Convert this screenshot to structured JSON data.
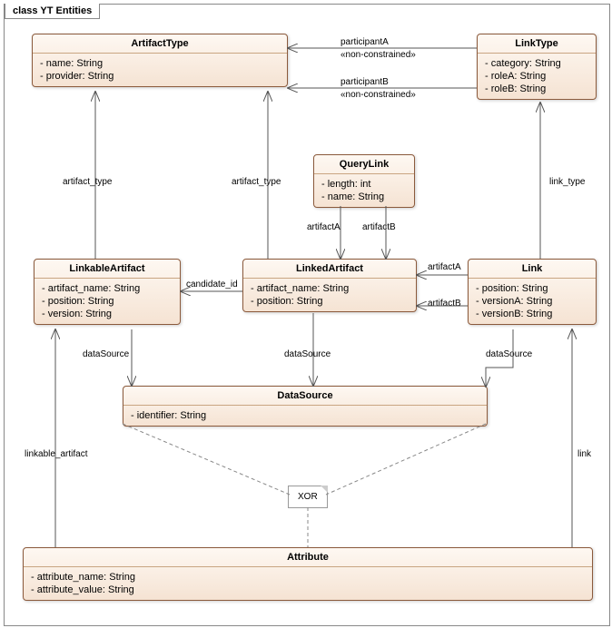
{
  "frame_title": "class YT Entities",
  "classes": {
    "ArtifactType": {
      "name": "ArtifactType",
      "attrs": [
        "name: String",
        "provider: String"
      ]
    },
    "LinkType": {
      "name": "LinkType",
      "attrs": [
        "category: String",
        "roleA: String",
        "roleB: String"
      ]
    },
    "QueryLink": {
      "name": "QueryLink",
      "attrs": [
        "length: int",
        "name: String"
      ]
    },
    "LinkableArtifact": {
      "name": "LinkableArtifact",
      "attrs": [
        "artifact_name: String",
        "position: String",
        "version: String"
      ]
    },
    "LinkedArtifact": {
      "name": "LinkedArtifact",
      "attrs": [
        "artifact_name: String",
        "position: String"
      ]
    },
    "Link": {
      "name": "Link",
      "attrs": [
        "position: String",
        "versionA: String",
        "versionB: String"
      ]
    },
    "DataSource": {
      "name": "DataSource",
      "attrs": [
        "identifier: String"
      ]
    },
    "Attribute": {
      "name": "Attribute",
      "attrs": [
        "attribute_name: String",
        "attribute_value: String"
      ]
    }
  },
  "labels": {
    "participantA": "participantA",
    "participantB": "participantB",
    "nonconstrained": "«non-constrained»",
    "artifact_type": "artifact_type",
    "link_type": "link_type",
    "artifactA": "artifactA",
    "artifactB": "artifactB",
    "candidate_id": "candidate_id",
    "dataSource": "dataSource",
    "linkable_artifact": "linkable_artifact",
    "link": "link",
    "xor": "XOR"
  },
  "chart_data": {
    "type": "uml-class-diagram",
    "classes": [
      {
        "name": "ArtifactType",
        "attributes": [
          {
            "name": "name",
            "type": "String"
          },
          {
            "name": "provider",
            "type": "String"
          }
        ]
      },
      {
        "name": "LinkType",
        "attributes": [
          {
            "name": "category",
            "type": "String"
          },
          {
            "name": "roleA",
            "type": "String"
          },
          {
            "name": "roleB",
            "type": "String"
          }
        ]
      },
      {
        "name": "QueryLink",
        "attributes": [
          {
            "name": "length",
            "type": "int"
          },
          {
            "name": "name",
            "type": "String"
          }
        ]
      },
      {
        "name": "LinkableArtifact",
        "attributes": [
          {
            "name": "artifact_name",
            "type": "String"
          },
          {
            "name": "position",
            "type": "String"
          },
          {
            "name": "version",
            "type": "String"
          }
        ]
      },
      {
        "name": "LinkedArtifact",
        "attributes": [
          {
            "name": "artifact_name",
            "type": "String"
          },
          {
            "name": "position",
            "type": "String"
          }
        ]
      },
      {
        "name": "Link",
        "attributes": [
          {
            "name": "position",
            "type": "String"
          },
          {
            "name": "versionA",
            "type": "String"
          },
          {
            "name": "versionB",
            "type": "String"
          }
        ]
      },
      {
        "name": "DataSource",
        "attributes": [
          {
            "name": "identifier",
            "type": "String"
          }
        ]
      },
      {
        "name": "Attribute",
        "attributes": [
          {
            "name": "attribute_name",
            "type": "String"
          },
          {
            "name": "attribute_value",
            "type": "String"
          }
        ]
      }
    ],
    "associations": [
      {
        "from": "LinkType",
        "to": "ArtifactType",
        "role": "participantA",
        "stereotype": "non-constrained",
        "nav": "to"
      },
      {
        "from": "LinkType",
        "to": "ArtifactType",
        "role": "participantB",
        "stereotype": "non-constrained",
        "nav": "to"
      },
      {
        "from": "LinkableArtifact",
        "to": "ArtifactType",
        "role": "artifact_type",
        "nav": "to"
      },
      {
        "from": "LinkedArtifact",
        "to": "ArtifactType",
        "role": "artifact_type",
        "nav": "to"
      },
      {
        "from": "Link",
        "to": "LinkType",
        "role": "link_type",
        "nav": "to"
      },
      {
        "from": "QueryLink",
        "to": "LinkedArtifact",
        "role": "artifactA",
        "nav": "to"
      },
      {
        "from": "QueryLink",
        "to": "LinkedArtifact",
        "role": "artifactB",
        "nav": "to"
      },
      {
        "from": "Link",
        "to": "LinkedArtifact",
        "role": "artifactA",
        "nav": "to"
      },
      {
        "from": "Link",
        "to": "LinkedArtifact",
        "role": "artifactB",
        "nav": "to"
      },
      {
        "from": "LinkedArtifact",
        "to": "LinkableArtifact",
        "role": "candidate_id",
        "nav": "to"
      },
      {
        "from": "LinkableArtifact",
        "to": "DataSource",
        "role": "dataSource",
        "nav": "to"
      },
      {
        "from": "LinkedArtifact",
        "to": "DataSource",
        "role": "dataSource",
        "nav": "to"
      },
      {
        "from": "Link",
        "to": "DataSource",
        "role": "dataSource",
        "nav": "to"
      },
      {
        "from": "Attribute",
        "to": "LinkableArtifact",
        "role": "linkable_artifact",
        "nav": "to"
      },
      {
        "from": "Attribute",
        "to": "Link",
        "role": "link",
        "nav": "to"
      }
    ],
    "constraints": [
      {
        "type": "xor",
        "between": [
          "Attribute->LinkableArtifact",
          "Attribute->Link"
        ],
        "via": "DataSource"
      }
    ]
  }
}
